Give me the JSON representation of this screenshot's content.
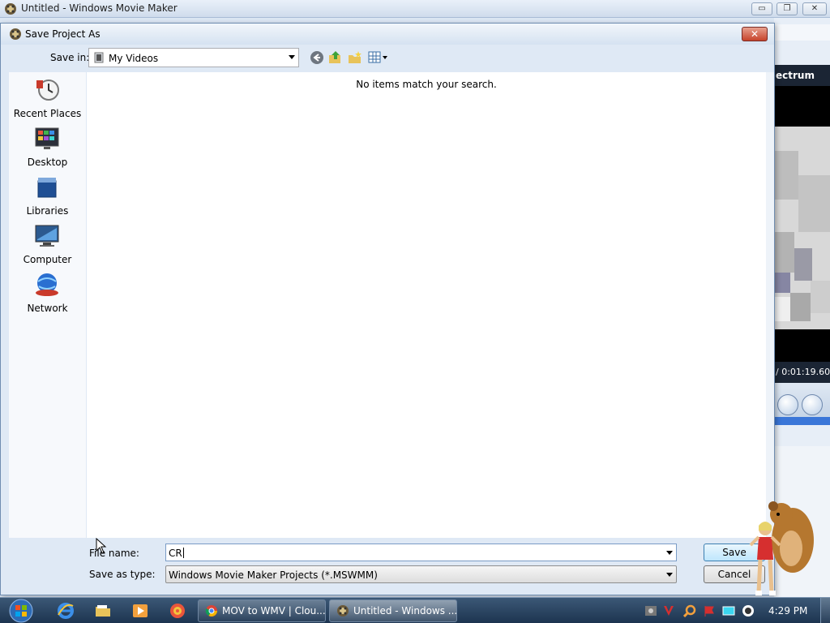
{
  "app": {
    "title": "Untitled - Windows Movie Maker",
    "window_buttons": {
      "minimize": "▭",
      "maximize": "❐",
      "close": "✕"
    },
    "preview": {
      "header": "ectrum",
      "time": "/ 0:01:19.60"
    }
  },
  "dialog": {
    "title": "Save Project As",
    "close_label": "✕",
    "save_in_label": "Save in:",
    "save_in_value": "My Videos",
    "empty_message": "No items match your search.",
    "places": [
      {
        "label": "Recent Places",
        "icon": "recent-places-icon"
      },
      {
        "label": "Desktop",
        "icon": "desktop-icon"
      },
      {
        "label": "Libraries",
        "icon": "libraries-icon"
      },
      {
        "label": "Computer",
        "icon": "computer-icon"
      },
      {
        "label": "Network",
        "icon": "network-icon"
      }
    ],
    "toolbar": {
      "back_icon": "back-arrow-icon",
      "up_icon": "up-folder-icon",
      "new_folder_icon": "new-folder-icon",
      "views_icon": "views-menu-icon"
    },
    "file_name_label": "File name:",
    "file_name_value": "CR",
    "save_as_type_label": "Save as type:",
    "save_as_type_value": "Windows Movie Maker Projects (*.MSWMM)",
    "save_button": "Save",
    "cancel_button": "Cancel"
  },
  "taskbar": {
    "tasks": [
      {
        "label": "MOV to WMV | Clou...",
        "icon": "chrome-icon",
        "active": false
      },
      {
        "label": "Untitled - Windows ...",
        "icon": "movie-maker-icon",
        "active": true
      }
    ],
    "clock": "4:29 PM"
  },
  "colors": {
    "accent": "#3c7fb1",
    "taskbar": "#1d3450",
    "dialog_bg": "#dfe9f5",
    "close_red": "#c6432b"
  }
}
